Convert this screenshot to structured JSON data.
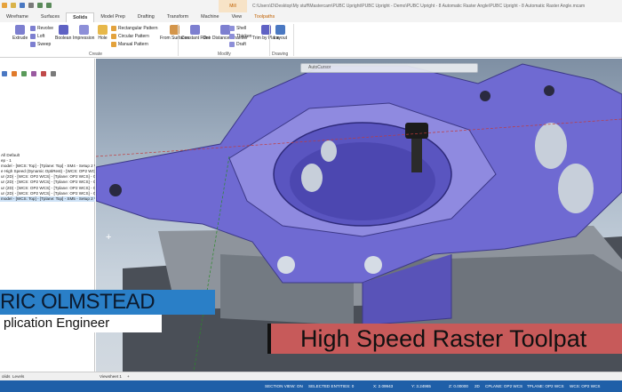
{
  "titlebar": {
    "context_tab": "Mill",
    "path": "C:\\Users\\D\\Desktop\\My stuff\\Mastercam\\PUBC Upright\\PUBC Upright - Demo\\PUBC Upright - 8 Automatic Raster Angle\\PUBC Upright - 8 Automatic Raster Angle.mcam"
  },
  "ribbon_tabs": [
    "Wireframe",
    "Surfaces",
    "Solids",
    "Model Prep",
    "Drafting",
    "Transform",
    "Machine",
    "View",
    "Toolpaths"
  ],
  "ribbon": {
    "extrude": "Extrude",
    "revolve": "Revolve",
    "loft": "Loft",
    "sweep": "Sweep",
    "boolean": "Boolean",
    "impression": "Impression",
    "hole": "Hole",
    "rectangular_pattern": "Rectangular Pattern",
    "circular_pattern": "Circular Pattern",
    "manual_pattern": "Manual Pattern",
    "from_surfaces": "From Surfaces",
    "constant_fillet": "Constant Fillet",
    "one_distance_chamfer": "One Distance Chamfer",
    "shell": "Shell",
    "thicken": "Thicken",
    "draft": "Draft",
    "trim_by_plane": "Trim by Plane",
    "layout": "Layout",
    "group_create": "Create",
    "group_modify": "Modify",
    "group_drawing": "Drawing"
  },
  "tree": {
    "rows": [
      "All Default",
      "ep - 1",
      "model - [WCS: Top] - [Tplane: Top] - SM4 - Setup 2 V",
      "e High Speed (Dynamic OptiRest) - [WCS: OP2 WCS] -",
      "ur (2D) - [WCS: OP2 WCS] - [Tplane: OP2 WCS] - Op",
      "ur (2D) - [WCS: OP2 WCS] - [Tplane: OP2 WCS] - Op",
      "ur (2D) - [WCS: OP2 WCS] - [Tplane: OP2 WCS] - Op",
      "ur (2D) - [WCS: OP2 WCS] - [Tplane: OP2 WCS] - Op",
      "model - [WCS: Top] - [Tplane: Top] - SM5 - Setup 2 V"
    ]
  },
  "viewport": {
    "toolbar_label": "AutoCursor"
  },
  "overlay": {
    "name": "RIC OLMSTEAD",
    "title": "plication Engineer",
    "topic": "High Speed Raster Toolpat"
  },
  "bottom_tabs": {
    "left1": "olids",
    "left2": "Levels",
    "viewsheet": "Viewsheet 1",
    "add": "+"
  },
  "status": {
    "section_view": "SECTION VIEW: ON",
    "selected": "SELECTED ENTITIES: 0",
    "x": "X:  2.09943",
    "y": "Y:  3.24965",
    "z": "Z:  0.00000",
    "mode": "2D",
    "cplane": "CPLANE: OP2 WCS",
    "tplane": "TPLANE: OP2 WCS",
    "wcs": "WCS: OP2 WCS"
  },
  "colors": {
    "part": "#6f6ad2",
    "status_bar": "#1f5fa8",
    "name_bar": "#2a7fc7",
    "topic_bar": "#c75a5a"
  }
}
